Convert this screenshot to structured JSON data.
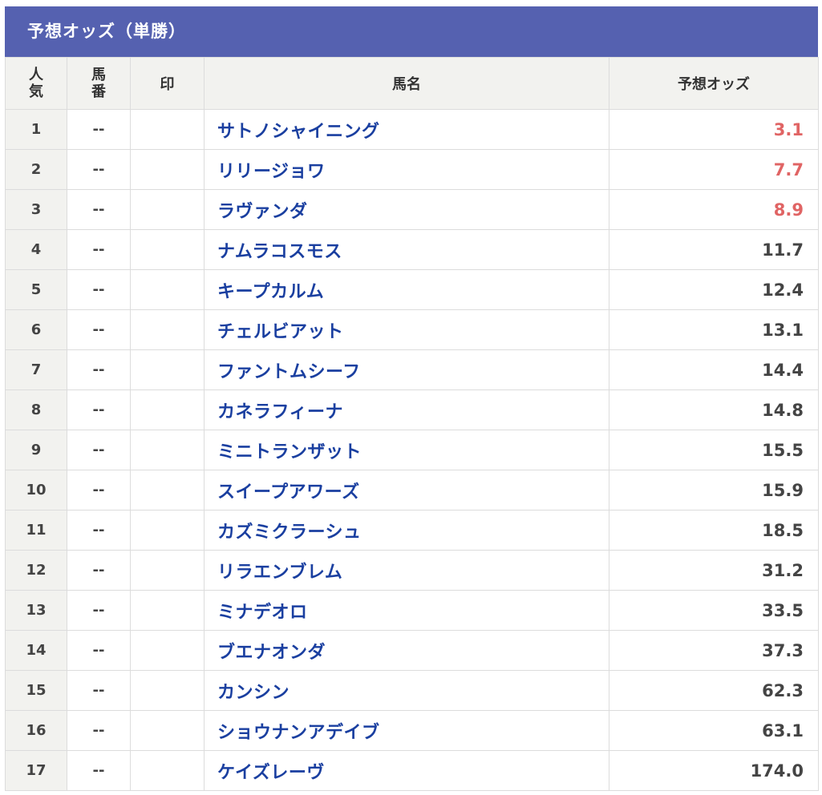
{
  "title": "予想オッズ（単勝）",
  "headers": {
    "rank_line1": "人",
    "rank_line2": "気",
    "number_line1": "馬",
    "number_line2": "番",
    "mark": "印",
    "name": "馬名",
    "odds": "予想オッズ"
  },
  "colors": {
    "header_bar": "#5561b0",
    "horse_name": "#1a3fa0",
    "top3_odds": "#e06464",
    "rank_cell_bg": "#f2f2ef"
  },
  "rows": [
    {
      "rank": "1",
      "number": "--",
      "mark": "",
      "name": "サトノシャイニング",
      "odds": "3.1"
    },
    {
      "rank": "2",
      "number": "--",
      "mark": "",
      "name": "リリージョワ",
      "odds": "7.7"
    },
    {
      "rank": "3",
      "number": "--",
      "mark": "",
      "name": "ラヴァンダ",
      "odds": "8.9"
    },
    {
      "rank": "4",
      "number": "--",
      "mark": "",
      "name": "ナムラコスモス",
      "odds": "11.7"
    },
    {
      "rank": "5",
      "number": "--",
      "mark": "",
      "name": "キープカルム",
      "odds": "12.4"
    },
    {
      "rank": "6",
      "number": "--",
      "mark": "",
      "name": "チェルビアット",
      "odds": "13.1"
    },
    {
      "rank": "7",
      "number": "--",
      "mark": "",
      "name": "ファントムシーフ",
      "odds": "14.4"
    },
    {
      "rank": "8",
      "number": "--",
      "mark": "",
      "name": "カネラフィーナ",
      "odds": "14.8"
    },
    {
      "rank": "9",
      "number": "--",
      "mark": "",
      "name": "ミニトランザット",
      "odds": "15.5"
    },
    {
      "rank": "10",
      "number": "--",
      "mark": "",
      "name": "スイープアワーズ",
      "odds": "15.9"
    },
    {
      "rank": "11",
      "number": "--",
      "mark": "",
      "name": "カズミクラーシュ",
      "odds": "18.5"
    },
    {
      "rank": "12",
      "number": "--",
      "mark": "",
      "name": "リラエンブレム",
      "odds": "31.2"
    },
    {
      "rank": "13",
      "number": "--",
      "mark": "",
      "name": "ミナデオロ",
      "odds": "33.5"
    },
    {
      "rank": "14",
      "number": "--",
      "mark": "",
      "name": "ブエナオンダ",
      "odds": "37.3"
    },
    {
      "rank": "15",
      "number": "--",
      "mark": "",
      "name": "カンシン",
      "odds": "62.3"
    },
    {
      "rank": "16",
      "number": "--",
      "mark": "",
      "name": "ショウナンアデイブ",
      "odds": "63.1"
    },
    {
      "rank": "17",
      "number": "--",
      "mark": "",
      "name": "ケイズレーヴ",
      "odds": "174.0"
    }
  ]
}
